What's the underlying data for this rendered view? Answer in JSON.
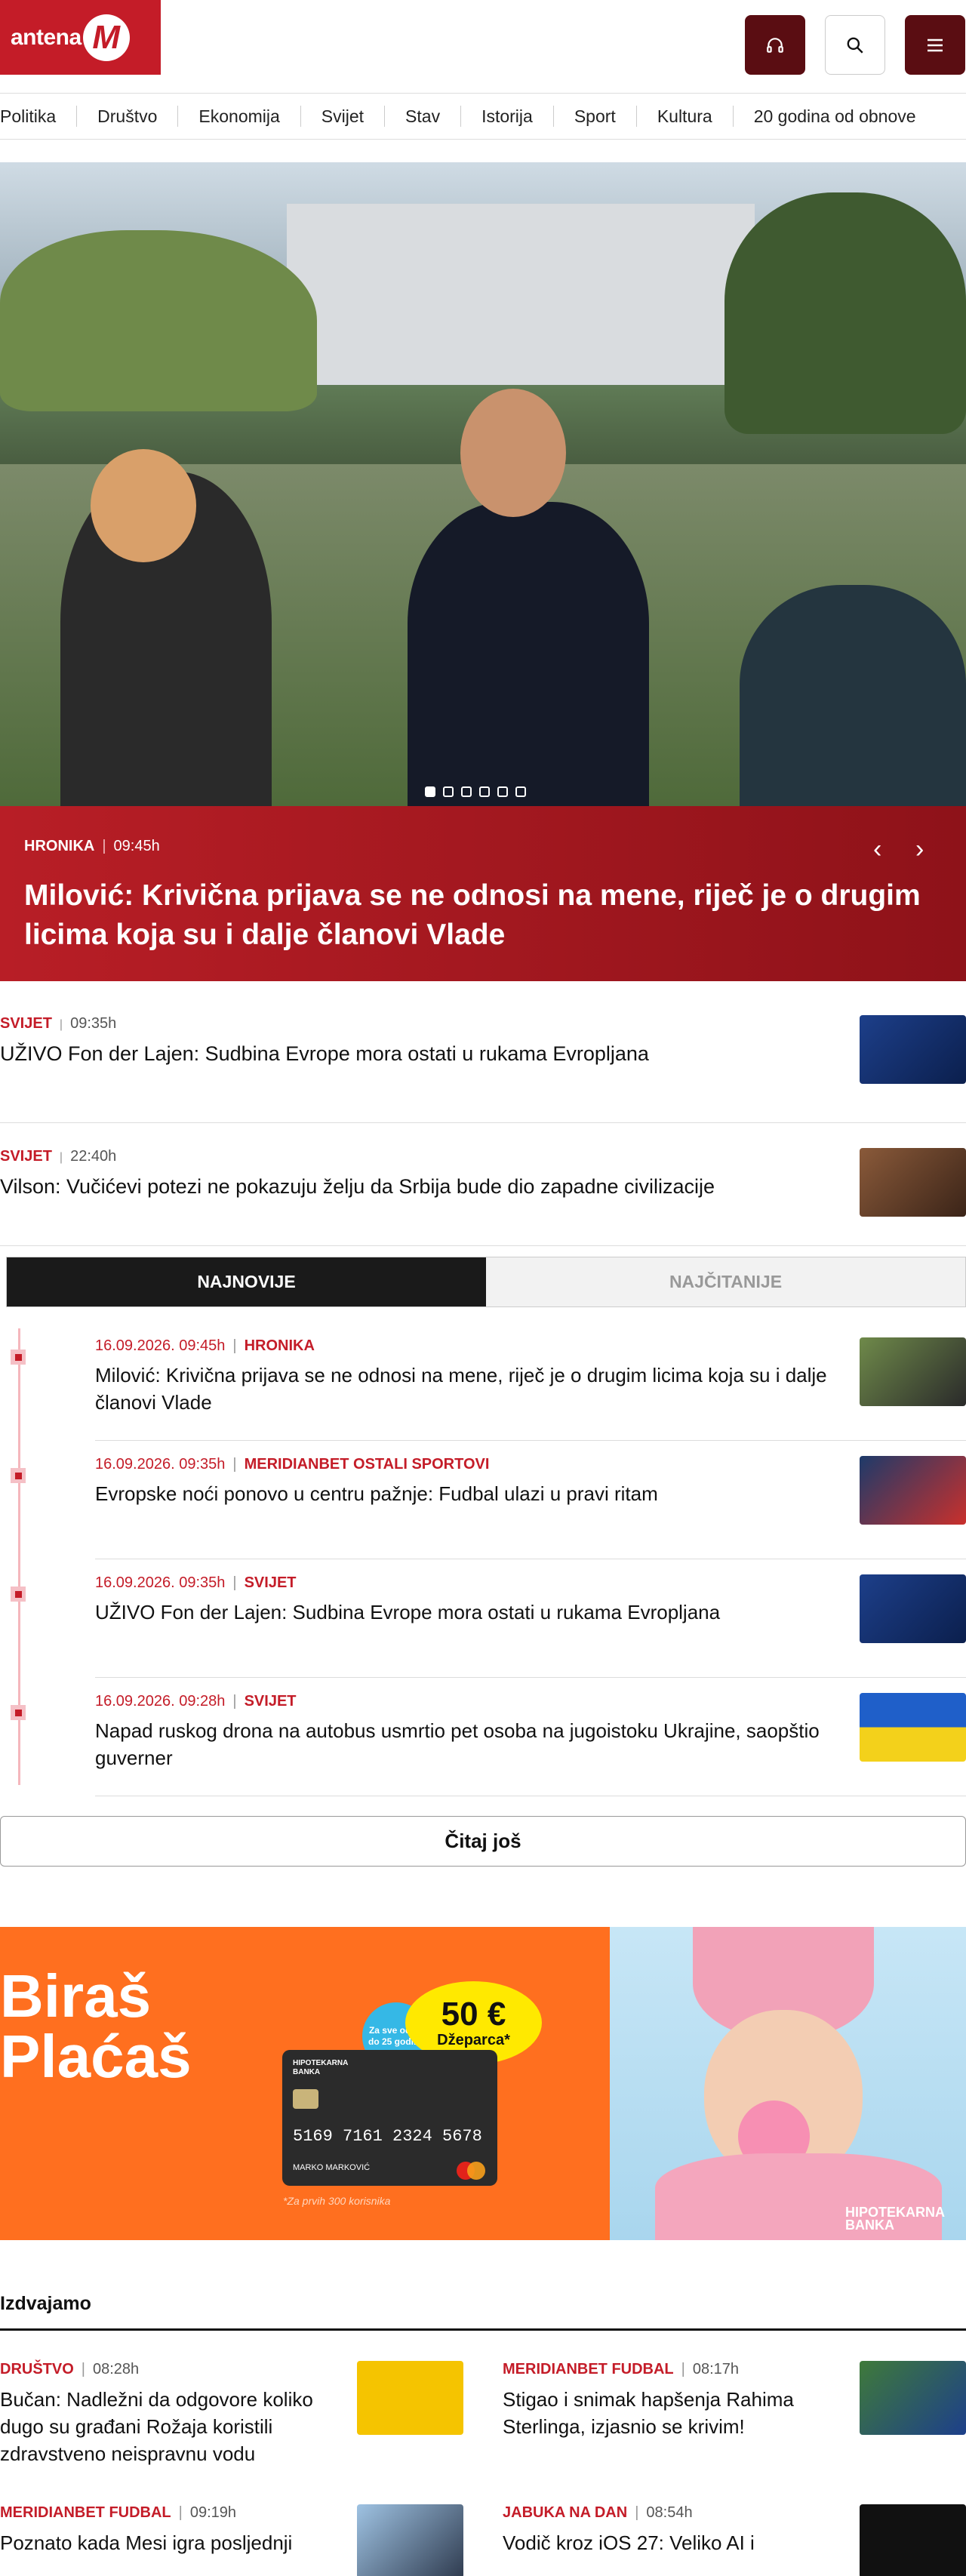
{
  "header": {
    "logo_text": "antena",
    "logo_letter": "M"
  },
  "nav": [
    "Politika",
    "Društvo",
    "Ekonomija",
    "Svijet",
    "Stav",
    "Istorija",
    "Sport",
    "Kultura",
    "20 godina od obnove"
  ],
  "hero": {
    "category": "HRONIKA",
    "time": "09:45h",
    "title": "Milović: Krivična prijava se ne odnosi na mene, riječ je o drugim licima koja su i dalje članovi Vlade",
    "slides": 6,
    "active_slide": 0
  },
  "stories": [
    {
      "category": "SVIJET",
      "time": "09:35h",
      "title": "UŽIVO Fon der Lajen: Sudbina Evrope mora ostati u rukama Evropljana"
    },
    {
      "category": "SVIJET",
      "time": "22:40h",
      "title": "Vilson: Vučićevi potezi ne pokazuju želju da Srbija bude dio zapadne civilizacije"
    }
  ],
  "tabs": {
    "latest": "NAJNOVIJE",
    "most_read": "NAJČITANIJE"
  },
  "timeline": [
    {
      "date": "16.09.2026. 09:45h",
      "category": "HRONIKA",
      "title": "Milović: Krivična prijava se ne odnosi na mene, riječ je o drugim licima koja su i dalje članovi Vlade"
    },
    {
      "date": "16.09.2026. 09:35h",
      "category": "MERIDIANBET OSTALI SPORTOVI",
      "title": "Evropske noći ponovo u centru pažnje: Fudbal ulazi u pravi ritam"
    },
    {
      "date": "16.09.2026. 09:35h",
      "category": "SVIJET",
      "title": "UŽIVO Fon der Lajen: Sudbina Evrope mora ostati u rukama Evropljana"
    },
    {
      "date": "16.09.2026. 09:28h",
      "category": "SVIJET",
      "title": "Napad ruskog drona na autobus usmrtio pet osoba na jugoistoku Ukrajine, saopštio guverner"
    }
  ],
  "read_more": "Čitaj još",
  "banner": {
    "headline": "Biraš\nPlaćaš",
    "badge": "Za sve od 15 do 25 godina",
    "amount": "50 €",
    "amount_label": "Džeparca*",
    "card_number": "5169 7161 2324 5678",
    "card_name": "MARKO MARKOVIĆ",
    "card_brand": "HIPOTEKARNA BANKA",
    "note": "*Za prvih 300 korisnika",
    "bank": "HIPOTEKARNA BANKA"
  },
  "featured": {
    "heading": "Izdvajamo",
    "items": [
      {
        "category": "DRUŠTVO",
        "time": "08:28h",
        "title": "Bučan: Nadležni da odgovore koliko dugo su građani Rožaja koristili zdravstveno neispravnu vodu"
      },
      {
        "category": "MERIDIANBET FUDBAL",
        "time": "08:17h",
        "title": "Stigao i snimak hapšenja Rahima Sterlinga, izjasnio se krivim!"
      },
      {
        "category": "MERIDIANBET FUDBAL",
        "time": "09:19h",
        "title": "Poznato kada Mesi igra posljednji"
      },
      {
        "category": "JABUKA NA DAN",
        "time": "08:54h",
        "title": "Vodič kroz iOS 27: Veliko AI i"
      }
    ]
  },
  "colors": {
    "brand": "#c41c28",
    "dark": "#5a0d12",
    "banner": "#ff6f1f"
  },
  "icons": {
    "audio": "headphones-icon",
    "search": "search-icon",
    "menu": "hamburger-menu-icon"
  }
}
